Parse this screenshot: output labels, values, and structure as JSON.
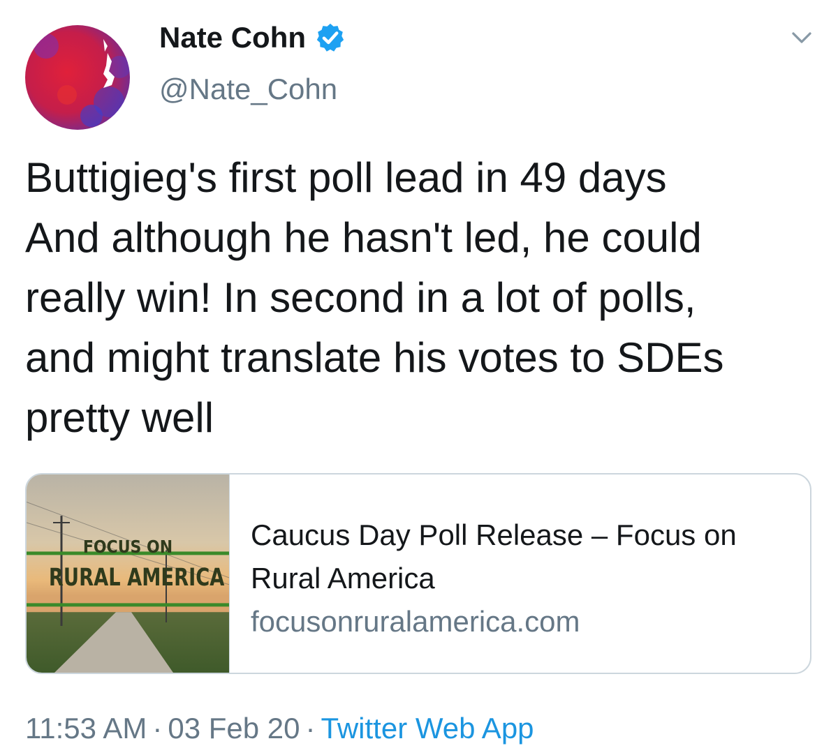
{
  "author": {
    "name": "Nate Cohn",
    "handle": "@Nate_Cohn",
    "verified": true,
    "avatar_icon": "map-avatar"
  },
  "tweet": {
    "lines": [
      "Buttigieg's first poll lead in 49 days",
      "And although he hasn't led, he could",
      "really win! In second in a lot of polls,",
      "and might translate his votes to SDEs",
      "pretty well"
    ]
  },
  "card": {
    "image_text": {
      "top": "FOCUS ON",
      "bottom": "RURAL AMERICA"
    },
    "title_lines": [
      "Caucus Day Poll Release – Focus on",
      "Rural America"
    ],
    "domain": "focusonruralamerica.com"
  },
  "meta": {
    "time": "11:53 AM",
    "date": "03 Feb 20",
    "separator": "·",
    "source": "Twitter Web App"
  },
  "colors": {
    "link": "#1b95e0",
    "secondary_text": "#657786",
    "verified_badge": "#1da1f2",
    "card_border": "#ccd6dd",
    "banner_green": "#3a8a2a"
  }
}
